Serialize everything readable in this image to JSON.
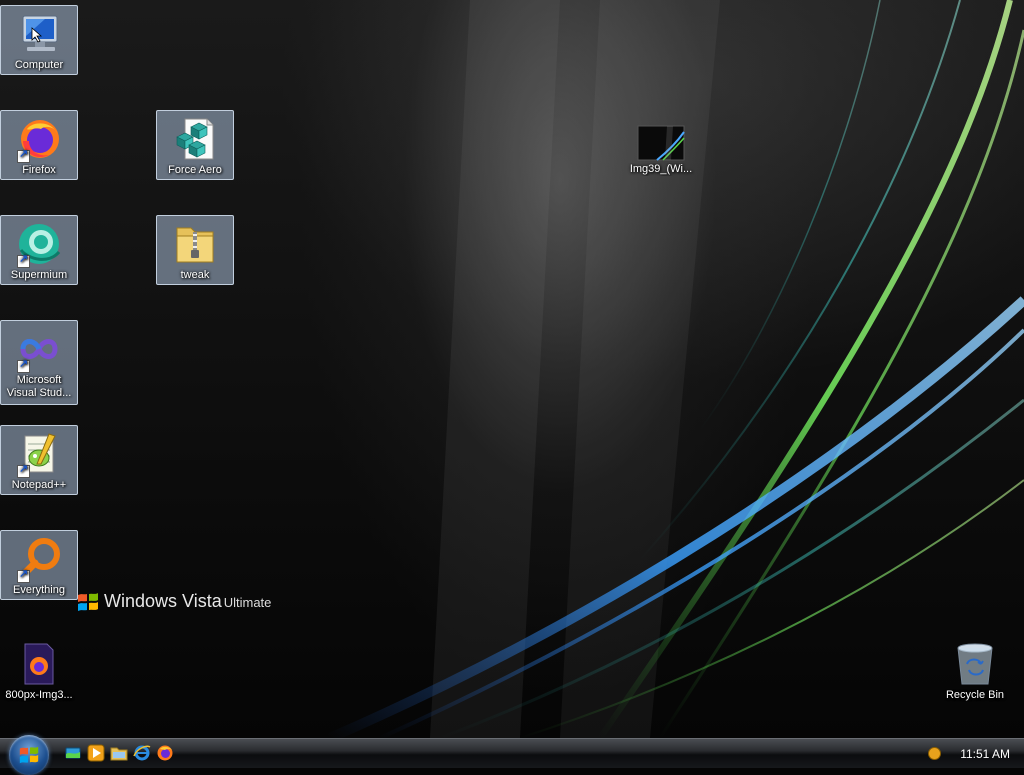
{
  "desktop_icons": {
    "computer": "Computer",
    "firefox": "Firefox",
    "force_aero": "Force Aero",
    "img39": "Img39_(Wi...",
    "supermium": "Supermium",
    "tweak": "tweak",
    "visual_studio": "Microsoft Visual Stud...",
    "notepadpp": "Notepad++",
    "everything": "Everything",
    "img_800px": "800px-Img3...",
    "recycle_bin": "Recycle Bin"
  },
  "watermark": {
    "brand": "Windows Vista",
    "edition": "Ultimate"
  },
  "taskbar": {
    "quick_launch": [
      "show-desktop-icon",
      "media-player-icon",
      "explorer-icon",
      "internet-explorer-icon",
      "firefox-icon"
    ],
    "clock": "11:51 AM"
  },
  "colors": {
    "taskbar": "#1a1c1f",
    "selection": "#aabed7",
    "wallpaper_blue": "#2a8cff",
    "wallpaper_green": "#5ad44a"
  }
}
